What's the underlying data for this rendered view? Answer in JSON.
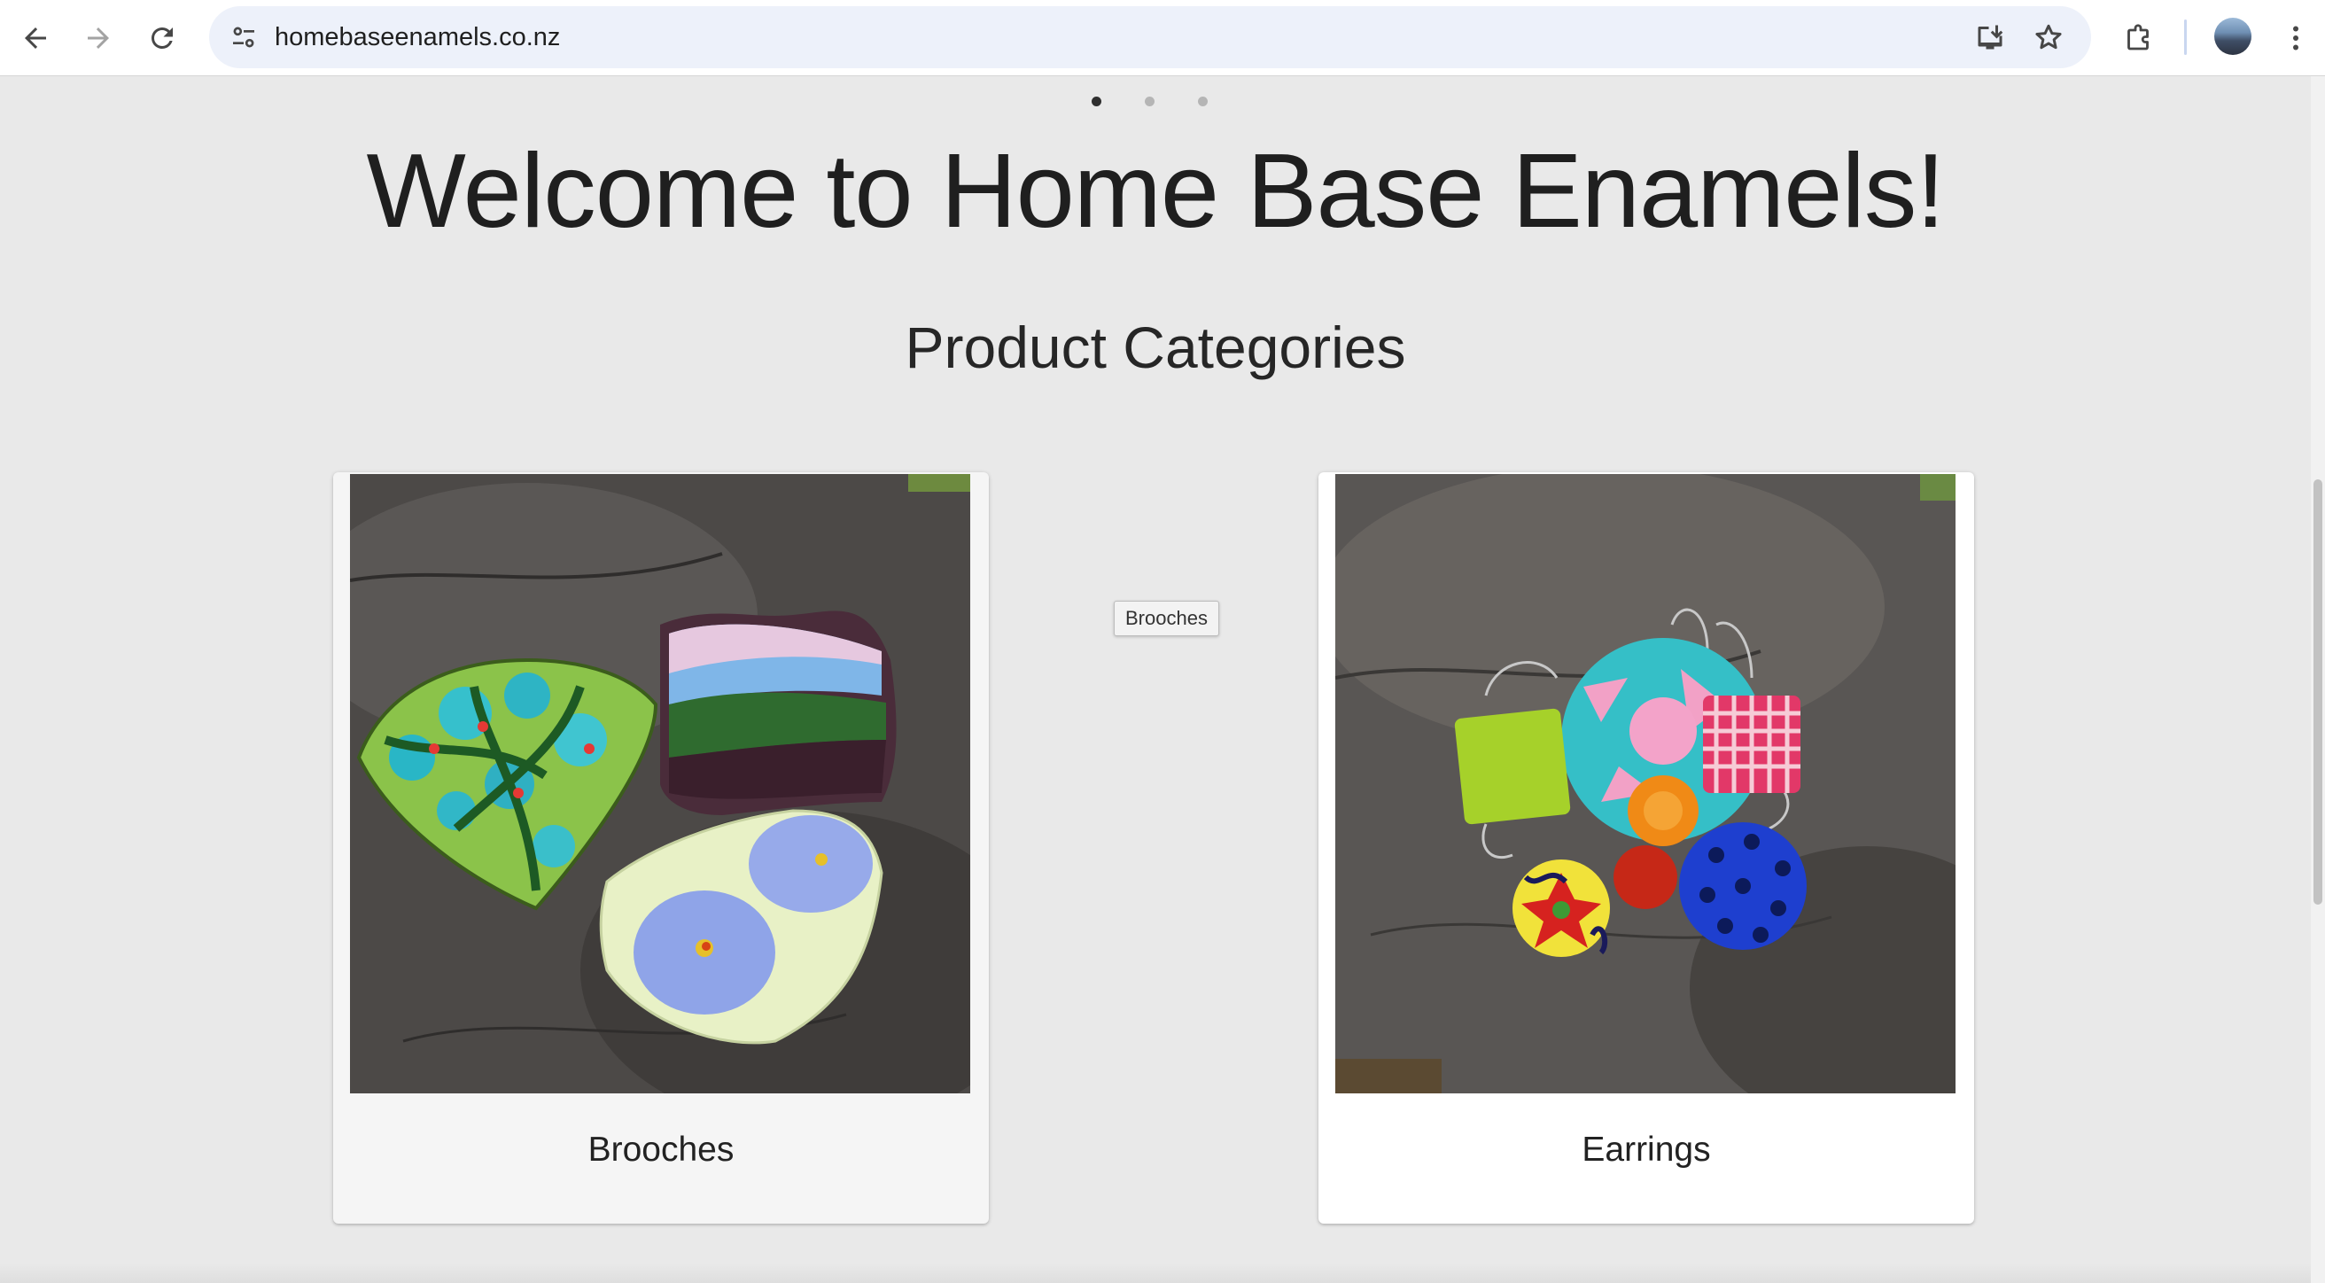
{
  "browser": {
    "url": "homebaseenamels.co.nz",
    "icons": {
      "back": "arrow-left-icon",
      "forward": "arrow-right-icon",
      "reload": "reload-icon",
      "site_info": "tune-icon",
      "install": "install-app-icon",
      "bookmark": "star-icon",
      "extensions": "puzzle-icon",
      "menu": "kebab-menu-icon"
    }
  },
  "carousel": {
    "slide_count": 3,
    "active_index": 0
  },
  "page": {
    "welcome": "Welcome to Home Base Enamels!",
    "section_title": "Product Categories"
  },
  "categories": [
    {
      "title": "Brooches"
    },
    {
      "title": "Earrings"
    }
  ],
  "tooltip": {
    "text": "Brooches"
  }
}
